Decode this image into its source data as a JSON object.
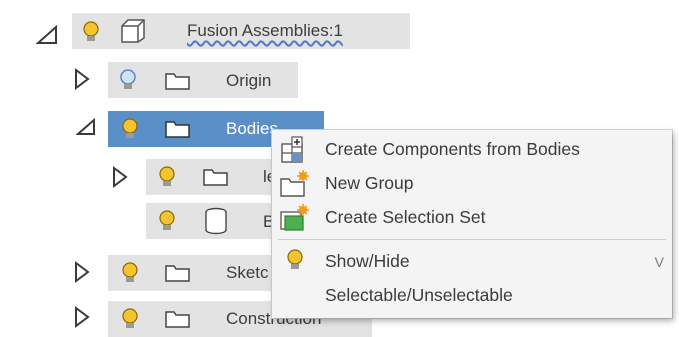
{
  "tree": {
    "root": {
      "label": "Fusion Assemblies:1"
    },
    "origin": {
      "label": "Origin"
    },
    "bodies": {
      "label": "Bodies"
    },
    "item_l": {
      "label_visible": "le"
    },
    "item_b": {
      "label_visible": "B"
    },
    "sketches": {
      "label_visible": "Sketc"
    },
    "construction": {
      "label": "Construction"
    }
  },
  "context_menu": {
    "items": [
      {
        "label": "Create Components from Bodies",
        "icon": "create-components-icon"
      },
      {
        "label": "New Group",
        "icon": "new-group-icon"
      },
      {
        "label": "Create Selection Set",
        "icon": "selection-set-icon"
      },
      {
        "label": "Show/Hide",
        "icon": "lightbulb-icon",
        "shortcut": "V"
      },
      {
        "label": "Selectable/Unselectable",
        "icon": ""
      }
    ]
  },
  "colors": {
    "selected_bg": "#5a8fc8",
    "row_bg": "#e3e3e3",
    "menu_bg": "#f4f4f4",
    "bulb_on": "#f4c430",
    "bulb_off": "#8fb4e6"
  }
}
